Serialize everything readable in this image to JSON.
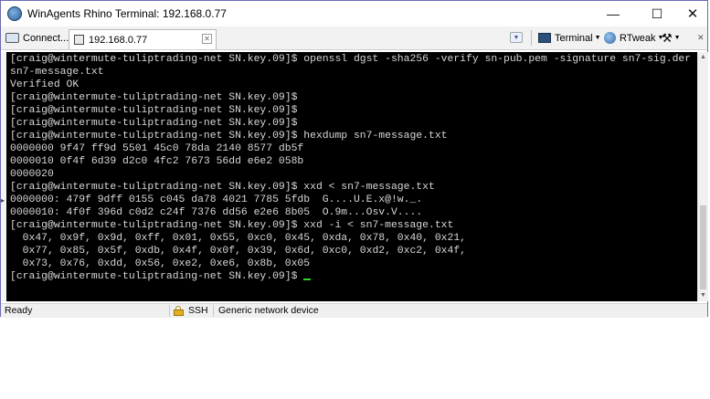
{
  "window": {
    "title": "WinAgents Rhino Terminal: 192.168.0.77",
    "controls": {
      "minimize": "—",
      "maximize": "☐",
      "close": "✕"
    }
  },
  "toolbar": {
    "connect_label": "Connect...",
    "tab_label": "192.168.0.77",
    "terminal_label": "Terminal",
    "rtweak_label": "RTweak",
    "tools_glyph": "⚒"
  },
  "terminal": {
    "lines": [
      "[craig@wintermute-tuliptrading-net SN.key.09]$ openssl dgst -sha256 -verify sn-pub.pem -signature sn7-sig.der",
      "sn7-message.txt",
      "Verified OK",
      "[craig@wintermute-tuliptrading-net SN.key.09]$",
      "[craig@wintermute-tuliptrading-net SN.key.09]$",
      "[craig@wintermute-tuliptrading-net SN.key.09]$",
      "[craig@wintermute-tuliptrading-net SN.key.09]$ hexdump sn7-message.txt",
      "0000000 9f47 ff9d 5501 45c0 78da 2140 8577 db5f",
      "0000010 0f4f 6d39 d2c0 4fc2 7673 56dd e6e2 058b",
      "0000020",
      "[craig@wintermute-tuliptrading-net SN.key.09]$ xxd < sn7-message.txt",
      "0000000: 479f 9dff 0155 c045 da78 4021 7785 5fdb  G....U.E.x@!w._.",
      "0000010: 4f0f 396d c0d2 c24f 7376 dd56 e2e6 8b05  O.9m...Osv.V....",
      "[craig@wintermute-tuliptrading-net SN.key.09]$ xxd -i < sn7-message.txt",
      "  0x47, 0x9f, 0x9d, 0xff, 0x01, 0x55, 0xc0, 0x45, 0xda, 0x78, 0x40, 0x21,",
      "  0x77, 0x85, 0x5f, 0xdb, 0x4f, 0x0f, 0x39, 0x6d, 0xc0, 0xd2, 0xc2, 0x4f,",
      "  0x73, 0x76, 0xdd, 0x56, 0xe2, 0xe6, 0x8b, 0x05",
      "[craig@wintermute-tuliptrading-net SN.key.09]$ "
    ]
  },
  "status": {
    "ready": "Ready",
    "protocol": "SSH",
    "device": "Generic network device"
  },
  "colors": {
    "terminal_bg": "#000000",
    "terminal_fg": "#d8d8d8",
    "cursor": "#2fd12f",
    "window_border": "#6b6bb3"
  }
}
